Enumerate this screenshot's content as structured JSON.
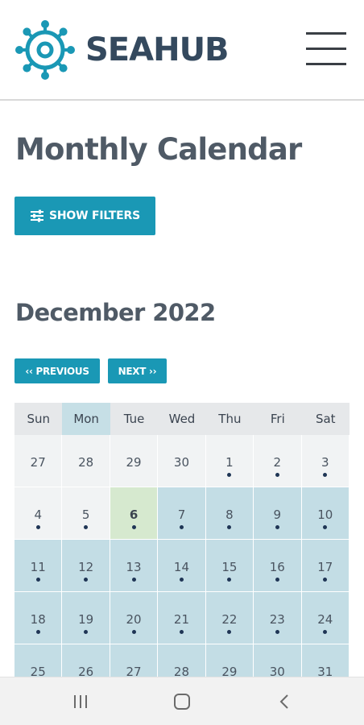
{
  "header": {
    "brand": "SEAHUB",
    "logo_icon": "ship-wheel-icon",
    "menu_icon": "hamburger-menu-icon"
  },
  "page": {
    "title": "Monthly Calendar",
    "filters_label": "SHOW FILTERS",
    "filters_icon": "sliders-icon"
  },
  "calendar": {
    "month_title": "December 2022",
    "prev_label": "‹‹ PREVIOUS",
    "next_label": "NEXT ››",
    "weekdays": [
      "Sun",
      "Mon",
      "Tue",
      "Wed",
      "Thu",
      "Fri",
      "Sat"
    ],
    "highlighted_weekday": "Mon",
    "weeks": [
      [
        {
          "day": "27",
          "dot": false,
          "state": "past"
        },
        {
          "day": "28",
          "dot": false,
          "state": "past"
        },
        {
          "day": "29",
          "dot": false,
          "state": "past"
        },
        {
          "day": "30",
          "dot": false,
          "state": "past"
        },
        {
          "day": "1",
          "dot": true,
          "state": "past"
        },
        {
          "day": "2",
          "dot": true,
          "state": "past"
        },
        {
          "day": "3",
          "dot": true,
          "state": "past"
        }
      ],
      [
        {
          "day": "4",
          "dot": true,
          "state": "past"
        },
        {
          "day": "5",
          "dot": true,
          "state": "past"
        },
        {
          "day": "6",
          "dot": true,
          "state": "today"
        },
        {
          "day": "7",
          "dot": true,
          "state": "future"
        },
        {
          "day": "8",
          "dot": true,
          "state": "future"
        },
        {
          "day": "9",
          "dot": true,
          "state": "future"
        },
        {
          "day": "10",
          "dot": true,
          "state": "future"
        }
      ],
      [
        {
          "day": "11",
          "dot": true,
          "state": "future"
        },
        {
          "day": "12",
          "dot": true,
          "state": "future"
        },
        {
          "day": "13",
          "dot": true,
          "state": "future"
        },
        {
          "day": "14",
          "dot": true,
          "state": "future"
        },
        {
          "day": "15",
          "dot": true,
          "state": "future"
        },
        {
          "day": "16",
          "dot": true,
          "state": "future"
        },
        {
          "day": "17",
          "dot": true,
          "state": "future"
        }
      ],
      [
        {
          "day": "18",
          "dot": true,
          "state": "future"
        },
        {
          "day": "19",
          "dot": true,
          "state": "future"
        },
        {
          "day": "20",
          "dot": true,
          "state": "future"
        },
        {
          "day": "21",
          "dot": true,
          "state": "future"
        },
        {
          "day": "22",
          "dot": true,
          "state": "future"
        },
        {
          "day": "23",
          "dot": true,
          "state": "future"
        },
        {
          "day": "24",
          "dot": true,
          "state": "future"
        }
      ],
      [
        {
          "day": "25",
          "dot": true,
          "state": "future"
        },
        {
          "day": "26",
          "dot": true,
          "state": "future"
        },
        {
          "day": "27",
          "dot": true,
          "state": "future"
        },
        {
          "day": "28",
          "dot": true,
          "state": "future"
        },
        {
          "day": "29",
          "dot": true,
          "state": "future"
        },
        {
          "day": "30",
          "dot": true,
          "state": "future"
        },
        {
          "day": "31",
          "dot": true,
          "state": "future"
        }
      ]
    ]
  },
  "system_nav": {
    "recents_icon": "recents-icon",
    "home_icon": "home-icon",
    "back_icon": "back-icon"
  },
  "colors": {
    "brand_teal": "#1a98b5",
    "brand_text": "#34495e",
    "future_cell": "#c3dde5",
    "past_cell": "#f1f3f4",
    "today_cell": "#d6e9cf",
    "event_dot": "#1f3555"
  }
}
